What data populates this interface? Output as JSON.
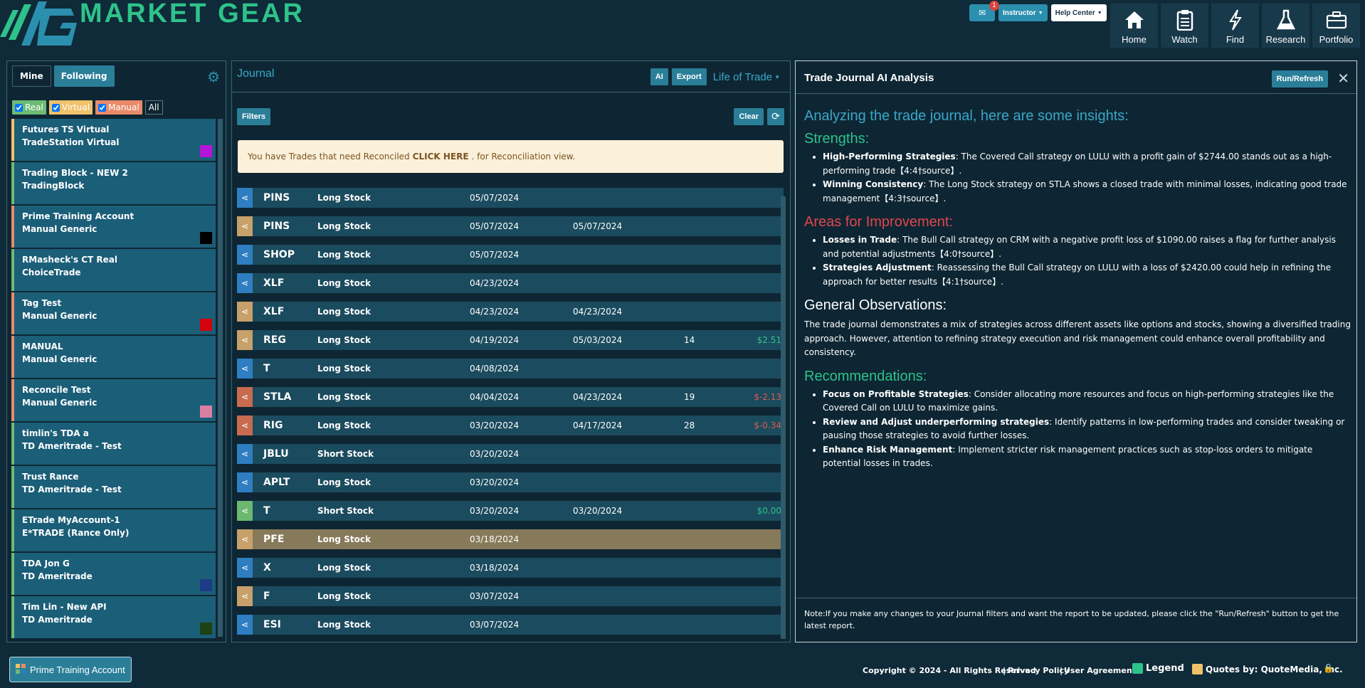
{
  "app": {
    "name": "MARKET GEAR"
  },
  "header": {
    "messages_badge": "1",
    "instructor_label": "Instructor",
    "help_label": "Help Center",
    "nav": [
      {
        "label": "Home",
        "icon": "home-icon"
      },
      {
        "label": "Watch",
        "icon": "clipboard-icon"
      },
      {
        "label": "Find",
        "icon": "bolt-icon"
      },
      {
        "label": "Research",
        "icon": "flask-icon"
      },
      {
        "label": "Portfolio",
        "icon": "briefcase-icon"
      }
    ]
  },
  "sidebar": {
    "tabs": {
      "mine": "Mine",
      "following": "Following"
    },
    "filters": {
      "real": "Real",
      "virtual": "Virtual",
      "manual": "Manual",
      "all": "All"
    },
    "accounts": [
      {
        "name": "Futures TS Virtual",
        "broker": "TradeStation Virtual",
        "type": "virtual",
        "swatch": "#b515d8"
      },
      {
        "name": "Trading Block - NEW 2",
        "broker": "TradingBlock",
        "type": "real",
        "swatch": ""
      },
      {
        "name": "Prime Training Account",
        "broker": "Manual Generic",
        "type": "manual",
        "swatch": "#000000"
      },
      {
        "name": "RMasheck's CT Real",
        "broker": "ChoiceTrade",
        "type": "real",
        "swatch": ""
      },
      {
        "name": "Tag Test",
        "broker": "Manual Generic",
        "type": "manual",
        "swatch": "#d2030f"
      },
      {
        "name": "MANUAL",
        "broker": "Manual Generic",
        "type": "manual",
        "swatch": ""
      },
      {
        "name": "Reconcile Test",
        "broker": "Manual Generic",
        "type": "manual",
        "swatch": "#d97fa3"
      },
      {
        "name": "timlin's TDA a",
        "broker": "TD Ameritrade - Test",
        "type": "real",
        "swatch": ""
      },
      {
        "name": "Trust Rance",
        "broker": "TD Ameritrade - Test",
        "type": "real",
        "swatch": ""
      },
      {
        "name": "ETrade MyAccount-1",
        "broker": "E*TRADE (Rance Only)",
        "type": "real",
        "swatch": ""
      },
      {
        "name": "TDA Jon G",
        "broker": "TD Ameritrade",
        "type": "real",
        "swatch": "#1d3b87"
      },
      {
        "name": "Tim Lin - New API",
        "broker": "TD Ameritrade",
        "type": "real",
        "swatch": "#1d4214"
      }
    ]
  },
  "journal": {
    "title": "Journal",
    "ai_label": "AI",
    "export_label": "Export",
    "view_label": "Life of Trade",
    "filters_label": "Filters",
    "clear_label": "Clear",
    "alert": {
      "before": "You have Trades that need Reconciled",
      "link": "CLICK HERE",
      "after": ". for Reconciliation view."
    },
    "trades": [
      {
        "symbol": "PINS",
        "strategy": "Long Stock",
        "open": "05/07/2024",
        "close": "",
        "days": "",
        "pl": "",
        "color": "blue",
        "sign": ""
      },
      {
        "symbol": "PINS",
        "strategy": "Long Stock",
        "open": "05/07/2024",
        "close": "05/07/2024",
        "days": "",
        "pl": "",
        "color": "tan",
        "sign": ""
      },
      {
        "symbol": "SHOP",
        "strategy": "Long Stock",
        "open": "05/07/2024",
        "close": "",
        "days": "",
        "pl": "",
        "color": "blue",
        "sign": ""
      },
      {
        "symbol": "XLF",
        "strategy": "Long Stock",
        "open": "04/23/2024",
        "close": "",
        "days": "",
        "pl": "",
        "color": "blue",
        "sign": ""
      },
      {
        "symbol": "XLF",
        "strategy": "Long Stock",
        "open": "04/23/2024",
        "close": "04/23/2024",
        "days": "",
        "pl": "",
        "color": "tan",
        "sign": ""
      },
      {
        "symbol": "REG",
        "strategy": "Long Stock",
        "open": "04/19/2024",
        "close": "05/03/2024",
        "days": "14",
        "pl": "$2.51",
        "color": "tan",
        "sign": "pos"
      },
      {
        "symbol": "T",
        "strategy": "Long Stock",
        "open": "04/08/2024",
        "close": "",
        "days": "",
        "pl": "",
        "color": "blue",
        "sign": ""
      },
      {
        "symbol": "STLA",
        "strategy": "Long Stock",
        "open": "04/04/2024",
        "close": "04/23/2024",
        "days": "19",
        "pl": "$-2.13",
        "color": "red",
        "sign": "neg"
      },
      {
        "symbol": "RIG",
        "strategy": "Long Stock",
        "open": "03/20/2024",
        "close": "04/17/2024",
        "days": "28",
        "pl": "$-0.34",
        "color": "red",
        "sign": "neg"
      },
      {
        "symbol": "JBLU",
        "strategy": "Short Stock",
        "open": "03/20/2024",
        "close": "",
        "days": "",
        "pl": "",
        "color": "blue",
        "sign": ""
      },
      {
        "symbol": "APLT",
        "strategy": "Long Stock",
        "open": "03/20/2024",
        "close": "",
        "days": "",
        "pl": "",
        "color": "blue",
        "sign": ""
      },
      {
        "symbol": "T",
        "strategy": "Short Stock",
        "open": "03/20/2024",
        "close": "03/20/2024",
        "days": "",
        "pl": "$0.00",
        "color": "green",
        "sign": "pos"
      },
      {
        "symbol": "PFE",
        "strategy": "Long Stock",
        "open": "03/18/2024",
        "close": "",
        "days": "",
        "pl": "",
        "color": "tan",
        "sign": "",
        "highlight": true
      },
      {
        "symbol": "X",
        "strategy": "Long Stock",
        "open": "03/18/2024",
        "close": "",
        "days": "",
        "pl": "",
        "color": "blue",
        "sign": ""
      },
      {
        "symbol": "F",
        "strategy": "Long Stock",
        "open": "03/07/2024",
        "close": "",
        "days": "",
        "pl": "",
        "color": "tan",
        "sign": ""
      },
      {
        "symbol": "ESI",
        "strategy": "Long Stock",
        "open": "03/07/2024",
        "close": "",
        "days": "",
        "pl": "",
        "color": "blue",
        "sign": ""
      }
    ]
  },
  "ai": {
    "title": "Trade Journal AI Analysis",
    "run_label": "Run/Refresh",
    "intro": "Analyzing the trade journal, here are some insights:",
    "strengths_title": "Strengths:",
    "strengths": [
      {
        "bold": "High-Performing Strategies",
        "text": ": The Covered Call strategy on LULU with a profit gain of $2744.00 stands out as a high-performing trade【4:4†source】."
      },
      {
        "bold": "Winning Consistency",
        "text": ": The Long Stock strategy on STLA shows a closed trade with minimal losses, indicating good trade management【4:3†source】."
      }
    ],
    "improve_title": "Areas for Improvement:",
    "improve": [
      {
        "bold": "Losses in Trade",
        "text": ": The Bull Call strategy on CRM with a negative profit loss of $1090.00 raises a flag for further analysis and potential adjustments【4:0†source】."
      },
      {
        "bold": "Strategies Adjustment",
        "text": ": Reassessing the Bull Call strategy on LULU with a loss of $2420.00 could help in refining the approach for better results【4:1†source】."
      }
    ],
    "general_title": "General Observations:",
    "general_text": "The trade journal demonstrates a mix of strategies across different assets like options and stocks, showing a diversified trading approach. However, attention to refining strategy execution and risk management could enhance overall profitability and consistency.",
    "rec_title": "Recommendations:",
    "recs": [
      {
        "bold": "Focus on Profitable Strategies",
        "text": ": Consider allocating more resources and focus on high-performing strategies like the Covered Call on LULU to maximize gains."
      },
      {
        "bold": "Review and Adjust underperforming strategies",
        "text": ": Identify patterns in low-performing trades and consider tweaking or pausing those strategies to avoid further losses."
      },
      {
        "bold": "Enhance Risk Management",
        "text": ": Implement stricter risk management practices such as stop-loss orders to mitigate potential losses in trades."
      }
    ],
    "note": "Note:If you make any changes to your Journal filters and want the report to be updated, please click the \"Run/Refresh\" button to get the latest report."
  },
  "footer": {
    "account_label": "Prime Training Account",
    "copyright": "Copyright © 2024 - All Rights Reserved",
    "privacy": "Privacy Policy",
    "agreement": "User Agreement",
    "legend": "Legend",
    "quotes": "Quotes by: QuoteMedia, Inc."
  }
}
